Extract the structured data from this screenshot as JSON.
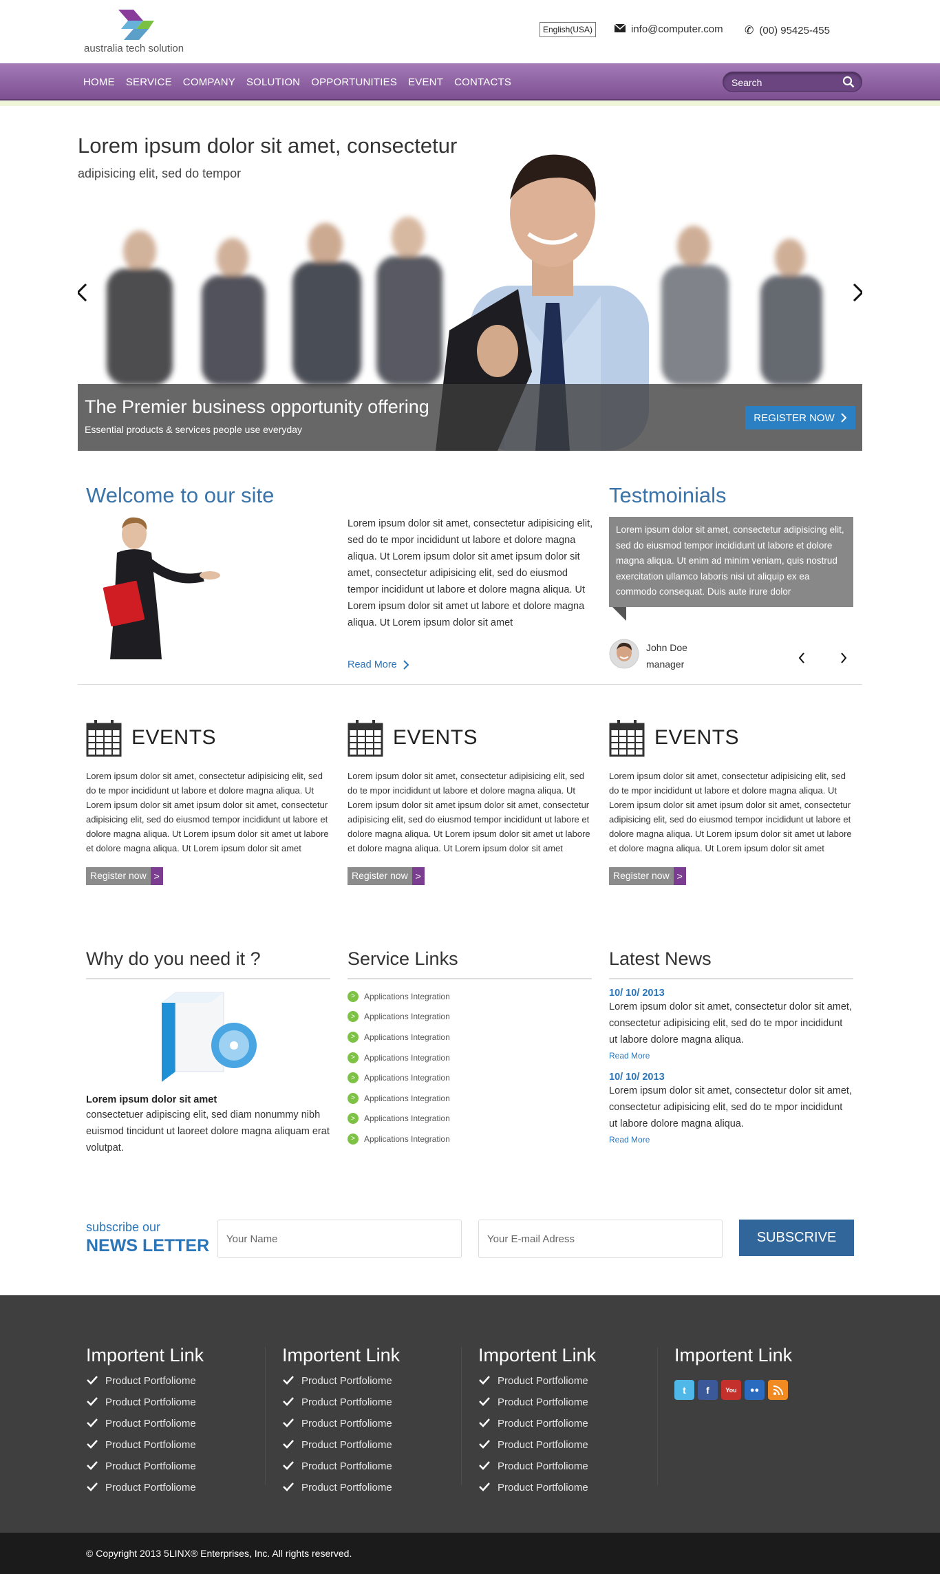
{
  "brand": {
    "name": "australia tech solution"
  },
  "header": {
    "language": "English(USA)",
    "email": "info@computer.com",
    "phone": "(00) 95425-455"
  },
  "nav": {
    "items": [
      "HOME",
      "SERVICE",
      "COMPANY",
      "SOLUTION",
      "OPPORTUNITIES",
      "EVENT",
      "CONTACTS"
    ],
    "search_placeholder": "Search"
  },
  "hero": {
    "title": "Lorem ipsum dolor sit amet, consectetur",
    "subtitle": "adipisicing elit, sed do tempor",
    "caption_title": "The Premier business opportunity offering",
    "caption_sub": "Essential products & services people use everyday",
    "register_label": "REGISTER NOW"
  },
  "welcome": {
    "heading": "Welcome to our site",
    "text": "Lorem ipsum dolor sit amet, consectetur adipisicing elit, sed do te mpor incididunt ut labore et dolore magna aliqua. Ut Lorem ipsum dolor sit amet ipsum dolor sit amet, consectetur adipisicing elit, sed do eiusmod tempor incididunt ut labore et dolore magna aliqua. Ut Lorem ipsum dolor sit amet ut labore et dolore magna aliqua. Ut Lorem ipsum dolor sit amet",
    "read_more": "Read More"
  },
  "testimonials": {
    "heading": "Testmoinials",
    "quote": "Lorem ipsum dolor sit amet, consectetur adipisicing elit, sed do eiusmod tempor incididunt ut labore et dolore magna aliqua. Ut enim ad minim veniam, quis nostrud exercitation ullamco laboris nisi ut aliquip ex ea commodo consequat. Duis aute irure dolor",
    "name": "John Doe",
    "role": "manager"
  },
  "events": [
    {
      "title": "EVENTS",
      "text": "Lorem ipsum dolor sit amet, consectetur adipisicing elit, sed do te mpor incididunt ut labore et dolore magna aliqua. Ut Lorem ipsum dolor sit amet ipsum dolor sit amet, consectetur adipisicing elit, sed do eiusmod tempor incididunt ut labore et dolore magna aliqua. Ut Lorem ipsum dolor sit amet ut labore et dolore magna aliqua. Ut Lorem ipsum dolor sit amet",
      "button": "Register now"
    },
    {
      "title": "EVENTS",
      "text": "Lorem ipsum dolor sit amet, consectetur adipisicing elit, sed do te mpor incididunt ut labore et dolore magna aliqua. Ut Lorem ipsum dolor sit amet ipsum dolor sit amet, consectetur adipisicing elit, sed do eiusmod tempor incididunt ut labore et dolore magna aliqua. Ut Lorem ipsum dolor sit amet ut labore et dolore magna aliqua. Ut Lorem ipsum dolor sit amet",
      "button": "Register now"
    },
    {
      "title": "EVENTS",
      "text": "Lorem ipsum dolor sit amet, consectetur adipisicing elit, sed do te mpor incididunt ut labore et dolore magna aliqua. Ut Lorem ipsum dolor sit amet ipsum dolor sit amet, consectetur adipisicing elit, sed do eiusmod tempor incididunt ut labore et dolore magna aliqua. Ut Lorem ipsum dolor sit amet ut labore et dolore magna aliqua. Ut Lorem ipsum dolor sit amet",
      "button": "Register now"
    }
  ],
  "why": {
    "heading": "Why do you need it ?",
    "bold": "Lorem ipsum dolor sit amet",
    "text": "consectetuer adipiscing elit, sed diam nonummy nibh euismod tincidunt ut laoreet dolore magna aliquam erat volutpat."
  },
  "service_links": {
    "heading": "Service Links",
    "items": [
      "Applications Integration",
      "Applications Integration",
      "Applications Integration",
      "Applications Integration",
      "Applications Integration",
      "Applications Integration",
      "Applications Integration",
      "Applications Integration"
    ]
  },
  "news": {
    "heading": "Latest News",
    "items": [
      {
        "date": "10/ 10/ 2013",
        "text": "Lorem ipsum dolor sit amet, consectetur dolor sit amet, consectetur adipisicing elit, sed do te mpor incididunt ut labore dolore magna aliqua.",
        "more": "Read More"
      },
      {
        "date": "10/ 10/ 2013",
        "text": "Lorem ipsum dolor sit amet, consectetur dolor sit amet, consectetur adipisicing elit, sed do te mpor incididunt ut labore dolore magna aliqua.",
        "more": "Read More"
      }
    ]
  },
  "newsletter": {
    "line1": "subscribe our",
    "line2": "NEWS LETTER",
    "name_placeholder": "Your Name",
    "email_placeholder": "Your E-mail Adress",
    "button": "SUBSCRIVE"
  },
  "footer": {
    "columns": [
      {
        "heading": "Importent Link",
        "items": [
          "Product Portfoliome",
          "Product Portfoliome",
          "Product Portfoliome",
          "Product Portfoliome",
          "Product Portfoliome",
          "Product Portfoliome"
        ]
      },
      {
        "heading": "Importent Link",
        "items": [
          "Product Portfoliome",
          "Product Portfoliome",
          "Product Portfoliome",
          "Product Portfoliome",
          "Product Portfoliome",
          "Product Portfoliome"
        ]
      },
      {
        "heading": "Importent Link",
        "items": [
          "Product Portfoliome",
          "Product Portfoliome",
          "Product Portfoliome",
          "Product Portfoliome",
          "Product Portfoliome",
          "Product Portfoliome"
        ]
      }
    ],
    "social_heading": "Importent Link",
    "social_icons": [
      "twitter-icon",
      "facebook-icon",
      "youtube-icon",
      "myspace-icon",
      "rss-icon"
    ],
    "copyright": "© Copyright 2013 5LINX® Enterprises, Inc. All rights reserved."
  },
  "colors": {
    "nav_purple": "#8b5ea2",
    "accent_blue": "#2b7fc3",
    "green": "#7ec245",
    "footer": "#3f3f3f"
  }
}
